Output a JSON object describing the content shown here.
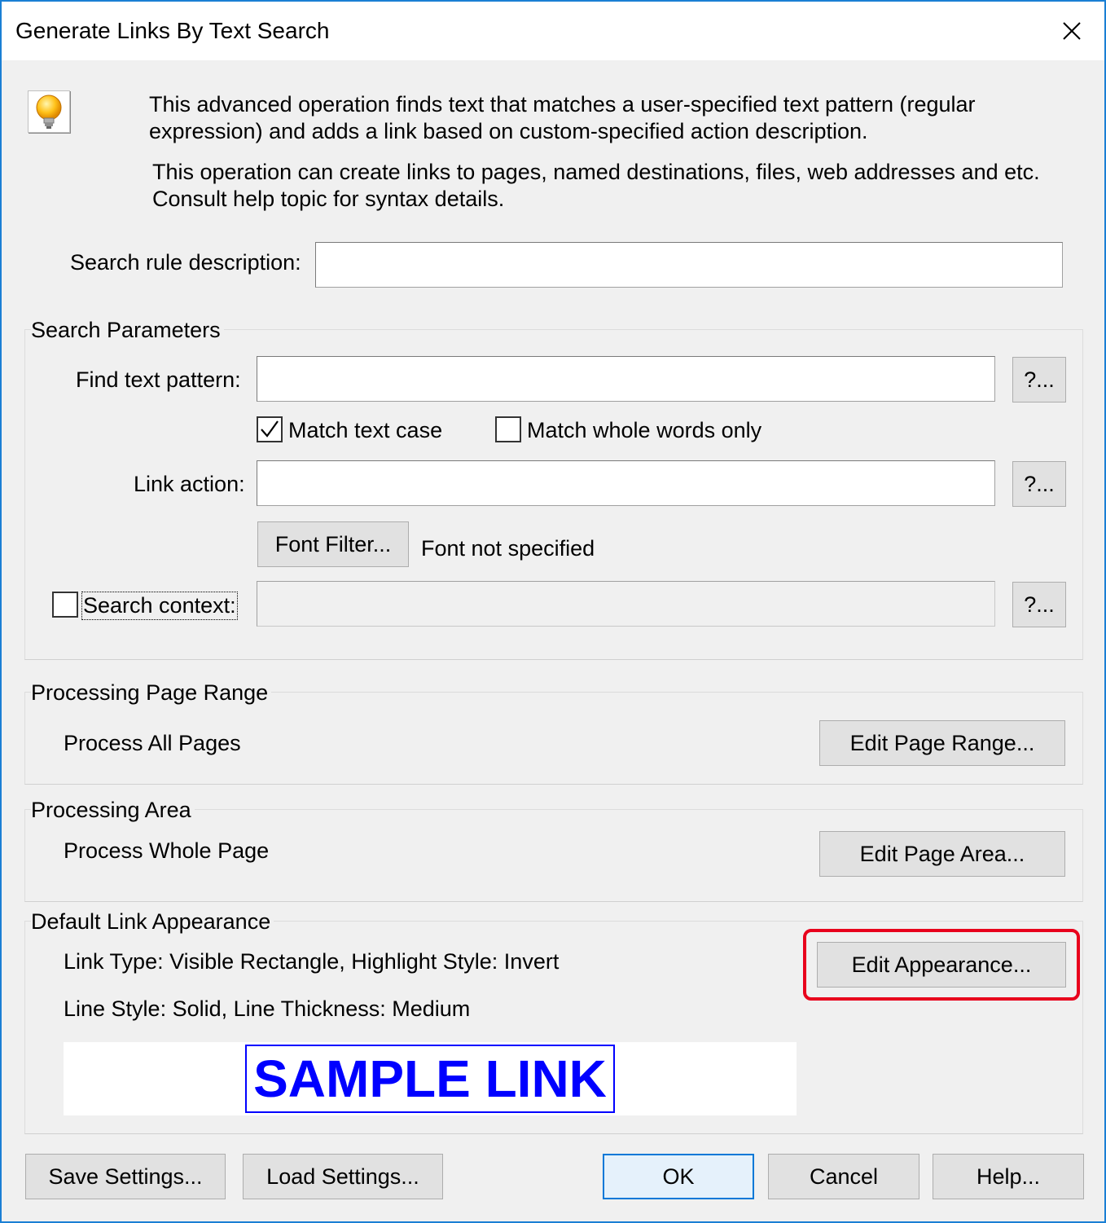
{
  "window": {
    "title": "Generate Links By Text Search",
    "close_glyph": "✕"
  },
  "intro": {
    "line1": "This advanced operation finds text that matches a user-specified text pattern (regular",
    "line2": "expression) and adds a link based on custom-specified action description.",
    "line3": "This operation can create links to pages, named destinations, files, web addresses and etc.",
    "line4": "Consult help topic for syntax details.",
    "icon": "lightbulb-icon"
  },
  "rule": {
    "label": "Search rule description:",
    "value": ""
  },
  "search_params": {
    "group_label": "Search Parameters",
    "find_label": "Find text pattern:",
    "find_value": "",
    "find_help": "?...",
    "match_case_label": "Match text case",
    "match_case_checked": true,
    "whole_words_label": "Match whole words only",
    "whole_words_checked": false,
    "link_action_label": "Link action:",
    "link_action_value": "",
    "link_action_help": "?...",
    "font_filter_button": "Font Filter...",
    "font_status": "Font not specified",
    "context_label": "Search context:",
    "context_checked": false,
    "context_value": "",
    "context_help": "?..."
  },
  "page_range": {
    "group_label": "Processing Page Range",
    "value": "Process All Pages",
    "button": "Edit Page Range..."
  },
  "area": {
    "group_label": "Processing Area",
    "value": "Process Whole Page",
    "button": "Edit Page Area..."
  },
  "appearance": {
    "group_label": "Default Link Appearance",
    "line1": "Link Type: Visible Rectangle, Highlight Style: Invert",
    "line2": "Line Style: Solid, Line Thickness: Medium",
    "button": "Edit Appearance...",
    "sample": "SAMPLE LINK",
    "sample_color": "#0000ff",
    "highlight_color": "#e8001c"
  },
  "footer": {
    "save": "Save Settings...",
    "load": "Load Settings...",
    "ok": "OK",
    "cancel": "Cancel",
    "help": "Help..."
  }
}
